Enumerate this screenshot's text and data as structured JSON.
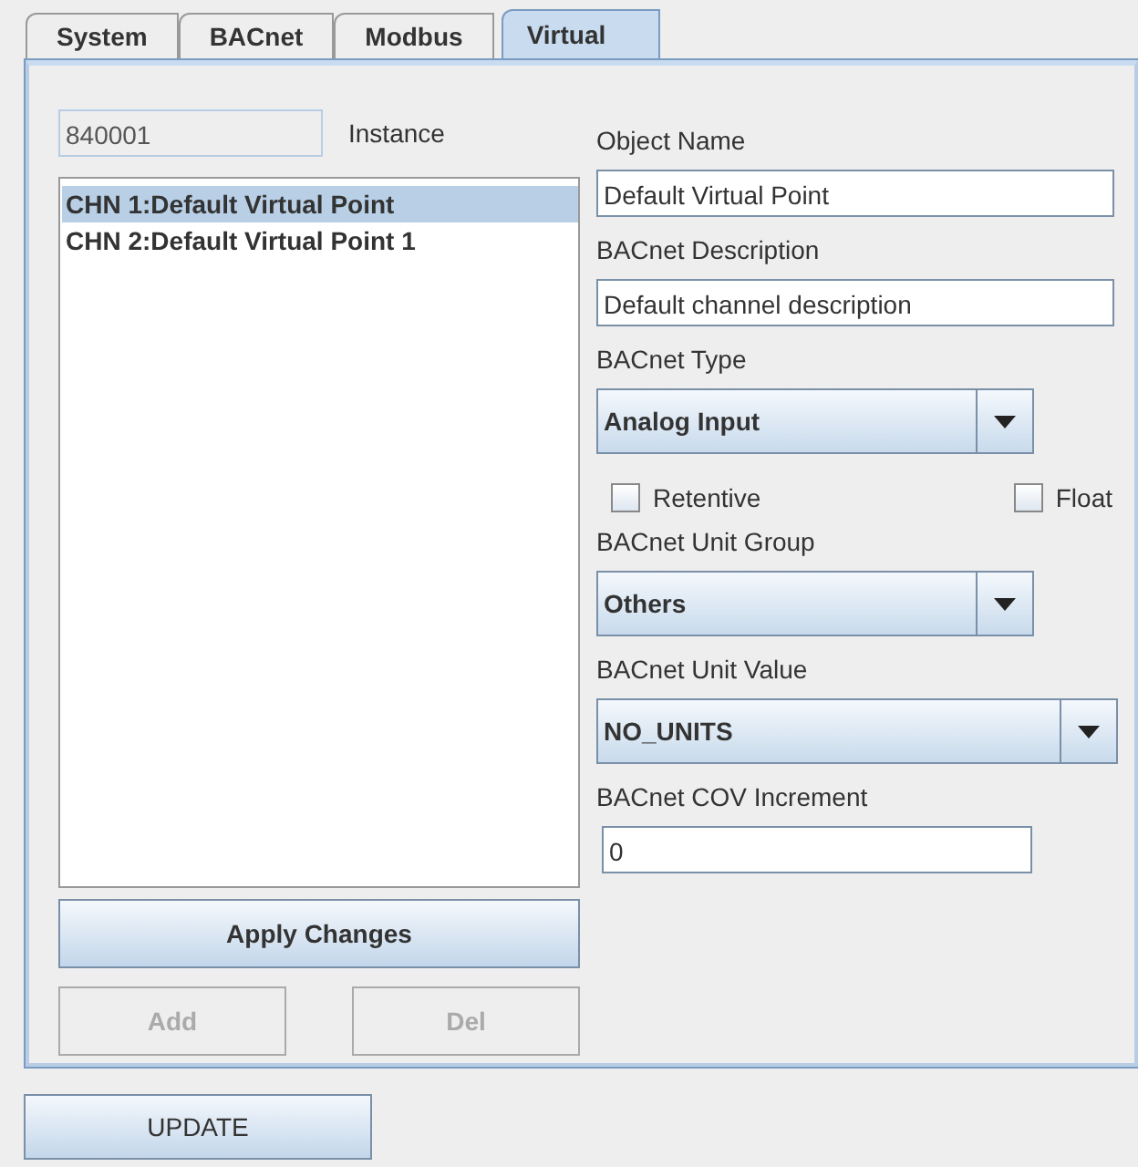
{
  "tabs": [
    {
      "label": "System",
      "selected": false
    },
    {
      "label": "BACnet",
      "selected": false
    },
    {
      "label": "Modbus",
      "selected": false
    },
    {
      "label": "Virtual",
      "selected": true
    }
  ],
  "instance": {
    "value": "840001",
    "label": "Instance",
    "disabled": true
  },
  "channels": [
    {
      "label": "CHN 1:Default Virtual Point",
      "selected": true
    },
    {
      "label": "CHN 2:Default Virtual Point 1",
      "selected": false
    }
  ],
  "apply_button": {
    "label": "Apply Changes",
    "disabled": false
  },
  "list_buttons": [
    {
      "label": "Add",
      "disabled": true
    },
    {
      "label": "Del",
      "disabled": true
    }
  ],
  "fields": [
    {
      "kind": "text",
      "label": "Object Name",
      "value": "Default Virtual Point"
    },
    {
      "kind": "text",
      "label": "BACnet Description",
      "value": "Default channel description"
    },
    {
      "kind": "combo",
      "label": "BACnet Type",
      "value": "Analog Input"
    },
    {
      "kind": "checks",
      "options": [
        {
          "label": "Retentive",
          "checked": false
        },
        {
          "label": "Float",
          "checked": false
        }
      ]
    },
    {
      "kind": "combo",
      "label": "BACnet Unit Group",
      "value": "Others"
    },
    {
      "kind": "combo",
      "label": "BACnet Unit Value",
      "value": "NO_UNITS"
    },
    {
      "kind": "text",
      "label": "BACnet COV Increment",
      "value": "0"
    }
  ],
  "update_button": {
    "label": "UPDATE"
  }
}
